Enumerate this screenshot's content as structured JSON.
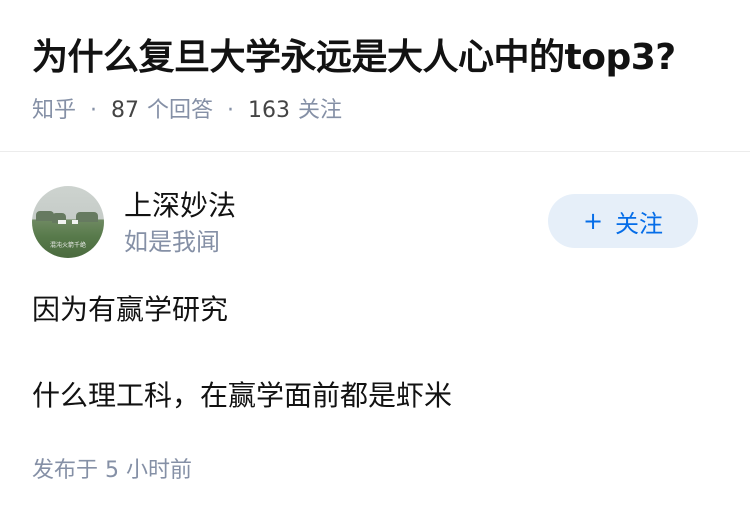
{
  "question": {
    "title": "为什么复旦大学永远是大人心中的top3?",
    "source": "知乎",
    "answers_count": "87",
    "answers_label": "个回答",
    "followers_count": "163",
    "followers_label": "关注"
  },
  "answer": {
    "author": {
      "name": "上深妙法",
      "bio": "如是我闻",
      "avatar_caption": "混沌火箭千绝",
      "follow_label": "关注",
      "follow_icon": "plus-icon"
    },
    "paragraphs": [
      "因为有赢学研究",
      "什么理工科，在赢学面前都是虾米"
    ],
    "time": "发布于 5 小时前"
  },
  "colors": {
    "meta_gray": "#8590a6",
    "accent_blue": "#056de8",
    "follow_bg": "#e6eff9"
  }
}
